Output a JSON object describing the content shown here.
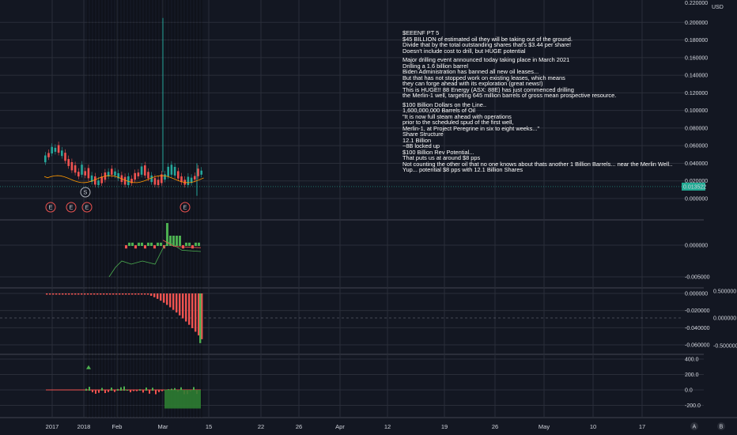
{
  "currency": "USD",
  "chart_data": [
    {
      "type": "line",
      "pane": "price",
      "last_price": "0.013522",
      "y_ticks": [
        "0.200000",
        "0.180000",
        "0.160000",
        "0.140000",
        "0.120000",
        "0.100000",
        "0.080000",
        "0.060000",
        "0.040000",
        "0.020000",
        "0.000000"
      ],
      "ylim": [
        0,
        0.22
      ],
      "markers": [
        "E",
        "E",
        "E",
        "S",
        "E"
      ],
      "annotation_lines": [
        "$EEENF PT 5",
        "$45 BILLION of estimated oil they will be taking out of the ground.",
        "Divide that by the total outstanding shares that's $3.44 per share!",
        "Doesn't include cost to drill, but HUGE potential",
        "",
        "Major drilling event announced today taking place in March 2021",
        "Drilling a 1.6 billion barrel",
        "Biden Administration has banned all new oil leases...",
        "But that has not stopped work on existing leases, which means",
        "they can forge ahead with its exploration (great news!)",
        "This is HUGE!! 88 Energy (ASX: 88E) has just commenced drilling",
        "the Merlin-1 well, targeting 645 million barrels of gross mean prospective resource.",
        "",
        "$100 Billion Dollars on the Line..",
        "1,600,000,000 Barrels of Oil",
        "\"It is now full steam ahead with operations",
        "prior to the scheduled spud of the first well,",
        "Merlin-1, at Project Peregrine in six to eight weeks...\"",
        "Share Structure",
        "12.1 Billion",
        "~8B locked up",
        "$100 Billion Rev Potential...",
        "That puts us at around $8 pps",
        "Not counting the other oil that no one knows about thats another 1 Billion Barrels... near the Merlin Well..",
        "Yup... potential $8 pps with 12.1 Billion Shares"
      ]
    },
    {
      "type": "line",
      "pane": "oscillator-1",
      "y_ticks": [
        "0.000000",
        "-0.005000"
      ]
    },
    {
      "type": "bar",
      "pane": "histogram",
      "y_ticks_left": [
        "0.000000",
        "-0.020000",
        "-0.040000",
        "-0.060000"
      ],
      "y_ticks_right": [
        "0.500000",
        "0.000000",
        "-0.500000"
      ]
    },
    {
      "type": "bar",
      "pane": "volume-oscillator",
      "y_ticks": [
        "400.0",
        "200.0",
        "0.0",
        "-200.0"
      ]
    }
  ],
  "time_axis": [
    "2017",
    "2018",
    "Feb",
    "Mar",
    "15",
    "22",
    "26",
    "Apr",
    "12",
    "19",
    "26",
    "May",
    "10",
    "17"
  ],
  "colors": {
    "background": "#131722",
    "up": "#26a69a",
    "down": "#ef5350",
    "grid": "#2a2e39",
    "price_tag": "#22ab94"
  },
  "scale_buttons": {
    "auto": "A",
    "log": "B"
  }
}
